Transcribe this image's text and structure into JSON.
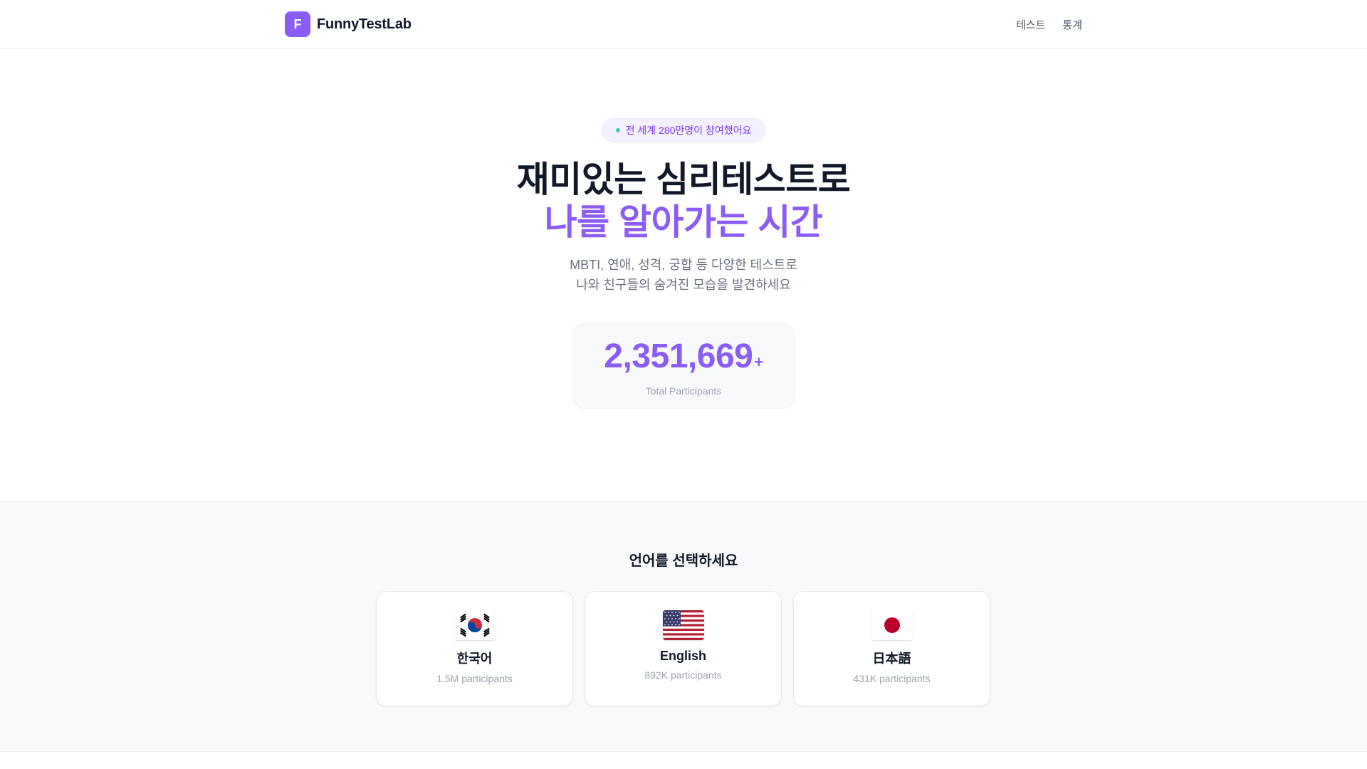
{
  "header": {
    "brand_initial": "F",
    "brand_name": "FunnyTestLab",
    "nav": [
      {
        "label": "테스트"
      },
      {
        "label": "통계"
      }
    ]
  },
  "hero": {
    "badge": "전 세계 280만명이 참여했어요",
    "title_line1": "재미있는 심리테스트로",
    "title_line2": "나를 알아가는 시간",
    "subtitle_line1": "MBTI, 연애, 성격, 궁합 등 다양한 테스트로",
    "subtitle_line2": "나와 친구들의 숨겨진 모습을 발견하세요",
    "stat_value": "2,351,669",
    "stat_suffix": "+",
    "stat_label": "Total Participants"
  },
  "languages": {
    "title": "언어를 선택하세요",
    "items": [
      {
        "name": "한국어",
        "count": "1.5M participants",
        "flag": "south-korea-flag-icon"
      },
      {
        "name": "English",
        "count": "892K participants",
        "flag": "united-states-flag-icon"
      },
      {
        "name": "日本語",
        "count": "431K participants",
        "flag": "japan-flag-icon"
      }
    ]
  },
  "colors": {
    "accent": "#8b5cf6",
    "accent_soft": "#f5f0fe",
    "badge_dot": "#34d399",
    "text_primary": "#111827",
    "text_muted": "#6b7280"
  }
}
